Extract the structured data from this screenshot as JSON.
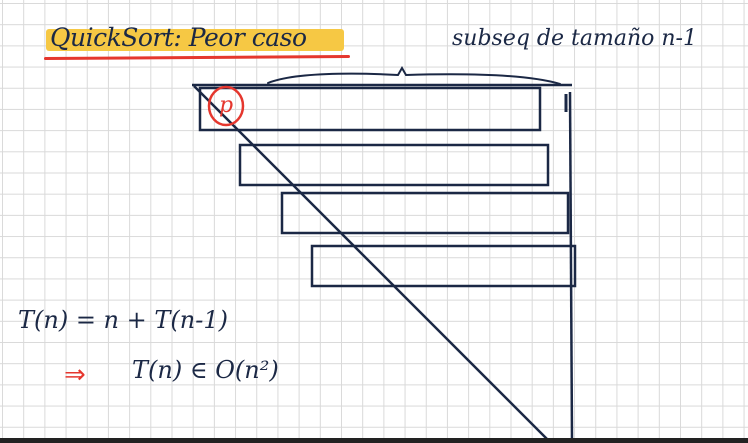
{
  "title": "QuickSort: Peor caso",
  "subseq_label": "subseq de tamaño n-1",
  "pivot_label": "p",
  "recurrence": "T(n) = n + T(n-1)",
  "result_arrow": "⇒",
  "result": "T(n) ∈ O(n²)",
  "colors": {
    "ink": "#1b2845",
    "highlight": "#f6c844",
    "accent_red": "#e5372e"
  }
}
